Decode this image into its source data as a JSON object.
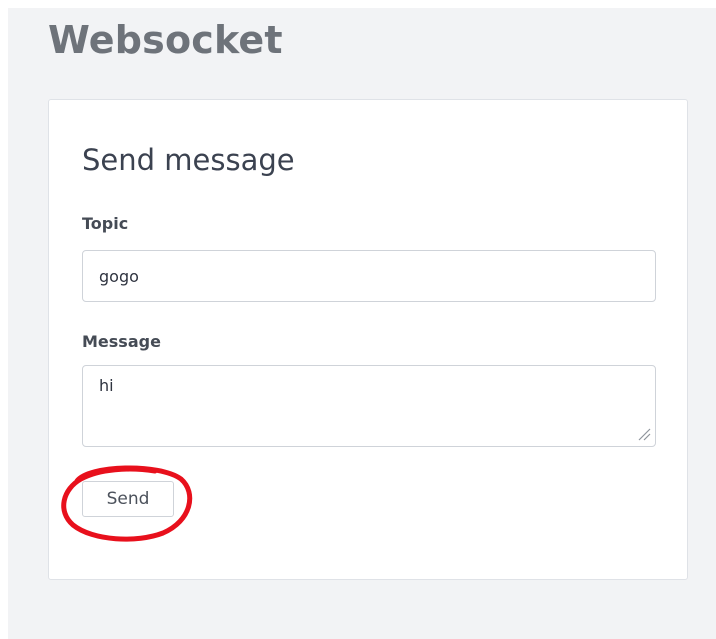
{
  "page": {
    "title": "Websocket"
  },
  "form": {
    "heading": "Send message",
    "topic_label": "Topic",
    "topic_value": "gogo",
    "message_label": "Message",
    "message_value": "hi",
    "send_label": "Send"
  },
  "annotation": {
    "circle_color": "#e8101c"
  }
}
